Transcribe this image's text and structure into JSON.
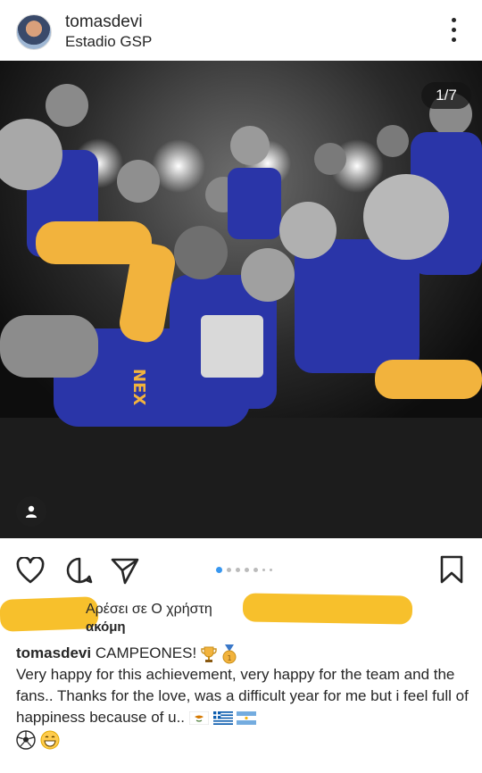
{
  "post": {
    "username": "tomasdevi",
    "location": "Estadio GSP",
    "counter": "1/7"
  },
  "likes": {
    "text": "Αρέσει σε Ο χρήστη",
    "more": "ακόμη"
  },
  "caption": {
    "username": "tomasdevi",
    "title": "CAMPEONES!",
    "body": "Very happy for this achievement, very happy for the team and the fans.. Thanks for the love, was a difficult year for me but i feel full of happiness because of u.."
  },
  "carousel": {
    "current": 1,
    "total": 7
  },
  "colors": {
    "accent": "#3897f0",
    "redaction": "#f7c02c",
    "jersey": "#2a35a8",
    "gold": "#f2b33d"
  },
  "icons": [
    "more-vertical-icon",
    "person-tag-icon",
    "heart-icon",
    "comment-icon",
    "share-icon",
    "bookmark-icon",
    "trophy-icon",
    "medal-icon",
    "cyprus-flag-icon",
    "greece-flag-icon",
    "argentina-flag-icon",
    "soccer-ball-icon",
    "grin-emoji-icon"
  ]
}
